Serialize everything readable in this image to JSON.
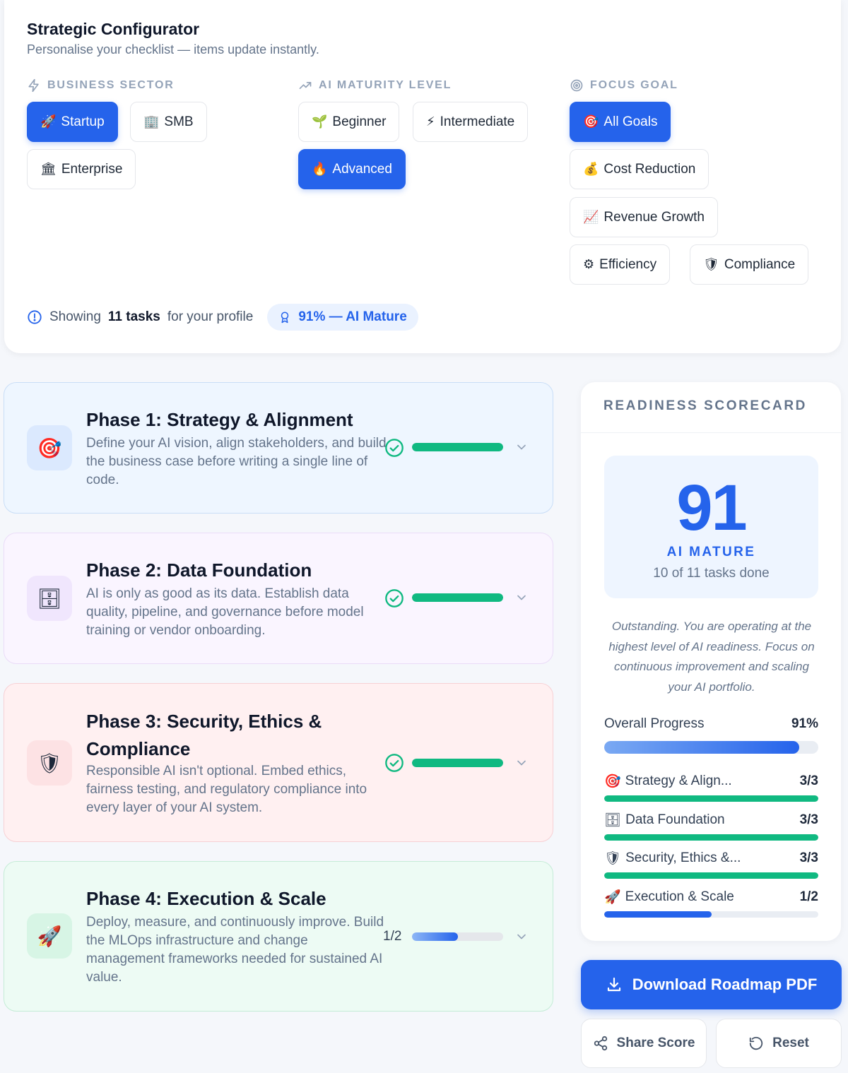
{
  "configurator": {
    "title": "Strategic Configurator",
    "subtitle": "Personalise your checklist — items update instantly.",
    "sector": {
      "label": "BUSINESS SECTOR",
      "options": [
        {
          "emoji": "🚀",
          "label": "Startup",
          "active": true
        },
        {
          "emoji": "🏢",
          "label": "SMB",
          "active": false
        },
        {
          "emoji": "🏛",
          "label": "Enterprise",
          "active": false
        }
      ]
    },
    "maturity": {
      "label": "AI MATURITY LEVEL",
      "options": [
        {
          "emoji": "🌱",
          "label": "Beginner",
          "active": false
        },
        {
          "emoji": "⚡",
          "label": "Intermediate",
          "active": false
        },
        {
          "emoji": "🔥",
          "label": "Advanced",
          "active": true
        }
      ]
    },
    "goal": {
      "label": "FOCUS GOAL",
      "options": [
        {
          "emoji": "🎯",
          "label": "All Goals",
          "active": true
        },
        {
          "emoji": "💰",
          "label": "Cost Reduction",
          "active": false
        },
        {
          "emoji": "📈",
          "label": "Revenue Growth",
          "active": false
        },
        {
          "emoji": "⚙",
          "label": "Efficiency",
          "active": false
        },
        {
          "emoji": "🛡",
          "label": "Compliance",
          "active": false
        }
      ]
    },
    "showing": {
      "prefix": "Showing",
      "count": "11 tasks",
      "suffix": "for your profile",
      "pill": "91% — AI Mature"
    }
  },
  "phases": [
    {
      "emoji": "🎯",
      "title": "Phase 1: Strategy & Alignment",
      "description": "Define your AI vision, align stakeholders, and build the business case before writing a single line of code.",
      "complete": true,
      "progress": 1.0,
      "count": ""
    },
    {
      "emoji": "🗄",
      "title": "Phase 2: Data Foundation",
      "description": "AI is only as good as its data. Establish data quality, pipeline, and governance before model training or vendor onboarding.",
      "complete": true,
      "progress": 1.0,
      "count": ""
    },
    {
      "emoji": "🛡",
      "title": "Phase 3: Security, Ethics & Compliance",
      "description": "Responsible AI isn't optional. Embed ethics, fairness testing, and regulatory compliance into every layer of your AI system.",
      "complete": true,
      "progress": 1.0,
      "count": ""
    },
    {
      "emoji": "🚀",
      "title": "Phase 4: Execution & Scale",
      "description": "Deploy, measure, and continuously improve. Build the MLOps infrastructure and change management frameworks needed for sustained AI value.",
      "complete": false,
      "progress": 0.5,
      "count": "1/2"
    }
  ],
  "scorecard": {
    "heading": "READINESS SCORECARD",
    "score": "91",
    "level": "AI MATURE",
    "done": "10 of 11 tasks done",
    "message": "Outstanding. You are operating at the highest level of AI readiness. Focus on continuous improvement and scaling your AI portfolio.",
    "overall_label": "Overall Progress",
    "overall_value": "91%",
    "overall_progress": 0.91,
    "breakdown": [
      {
        "emoji": "🎯",
        "label": "Strategy & Align...",
        "value": "3/3",
        "progress": 1.0
      },
      {
        "emoji": "🗄",
        "label": "Data Foundation",
        "value": "3/3",
        "progress": 1.0
      },
      {
        "emoji": "🛡",
        "label": "Security, Ethics &...",
        "value": "3/3",
        "progress": 1.0
      },
      {
        "emoji": "🚀",
        "label": "Execution & Scale",
        "value": "1/2",
        "progress": 0.5
      }
    ]
  },
  "actions": {
    "download": "Download Roadmap PDF",
    "share": "Share Score",
    "reset": "Reset"
  },
  "colors": {
    "accent": "#2563eb",
    "success": "#10b981"
  }
}
